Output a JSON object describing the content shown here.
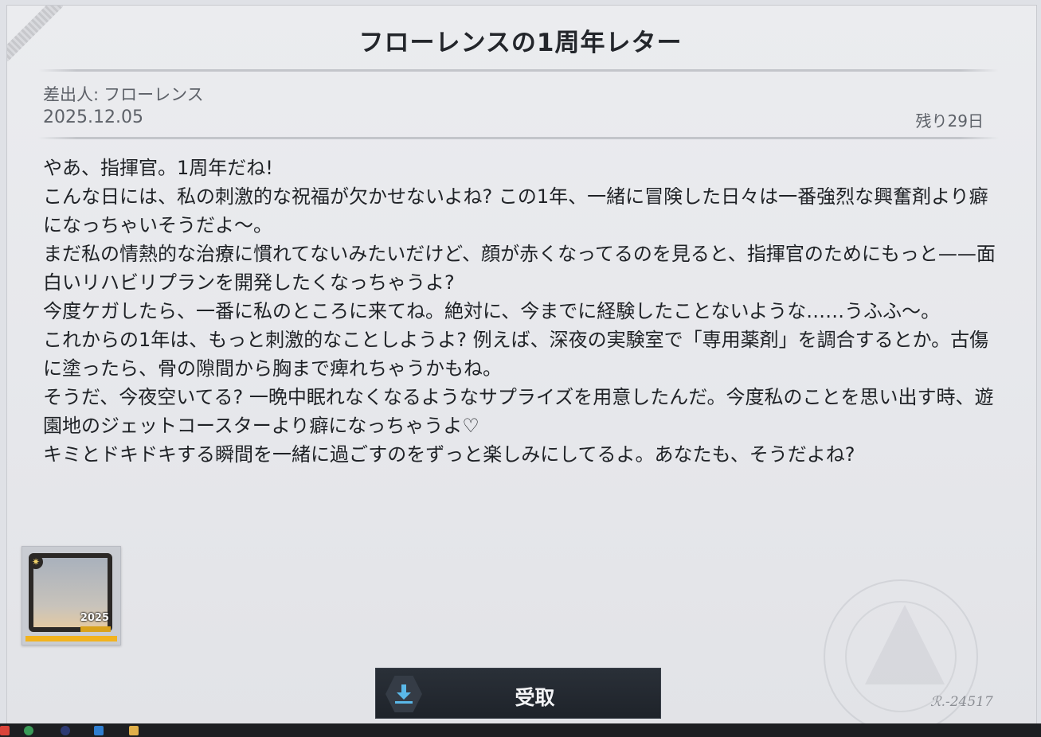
{
  "letter": {
    "title": "フローレンスの1周年レター",
    "sender_label": "差出人:",
    "sender_name": "フローレンス",
    "date": "2025.12.05",
    "remaining": "残り29日",
    "paragraphs": [
      "やあ、指揮官。1周年だね!",
      "こんな日には、私の刺激的な祝福が欠かせないよね? この1年、一緒に冒険した日々は一番強烈な興奮剤より癖になっちゃいそうだよ〜。",
      "まだ私の情熱的な治療に慣れてないみたいだけど、顔が赤くなってるのを見ると、指揮官のためにもっと——面白いリハビリプランを開発したくなっちゃうよ?",
      "今度ケガしたら、一番に私のところに来てね。絶対に、今までに経験したことないような……うふふ〜。",
      "これからの1年は、もっと刺激的なことしようよ? 例えば、深夜の実験室で「専用薬剤」を調合するとか。古傷に塗ったら、骨の隙間から胸まで痺れちゃうかもね。",
      "そうだ、今夜空いてる? 一晩中眠れなくなるようなサプライズを用意したんだ。今度私のことを思い出す時、遊園地のジェットコースターより癖になっちゃうよ♡",
      "キミとドキドキする瞬間を一緒に過ごすのをずっと楽しみにしてるよ。あなたも、そうだよね?"
    ]
  },
  "reward": {
    "year_text": "2025",
    "icon": "frame-reward-icon",
    "accent": "#f2b31e"
  },
  "claim_button": {
    "label": "受取",
    "icon": "download-icon"
  },
  "colors": {
    "panel": "#e8e9ec",
    "button": "#1e232a",
    "download_icon": "#5ab8e8"
  }
}
